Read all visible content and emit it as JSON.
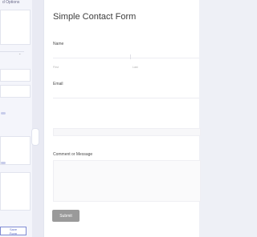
{
  "sidebar": {
    "title": "d Options",
    "button_label": "Save Form"
  },
  "form": {
    "title": "Simple Contact Form",
    "fields": {
      "name_label": "Name",
      "first_sub": "First",
      "last_sub": "Last",
      "email_label": "Email",
      "comment_label": "Comment or Message"
    },
    "submit_label": "Submit"
  }
}
